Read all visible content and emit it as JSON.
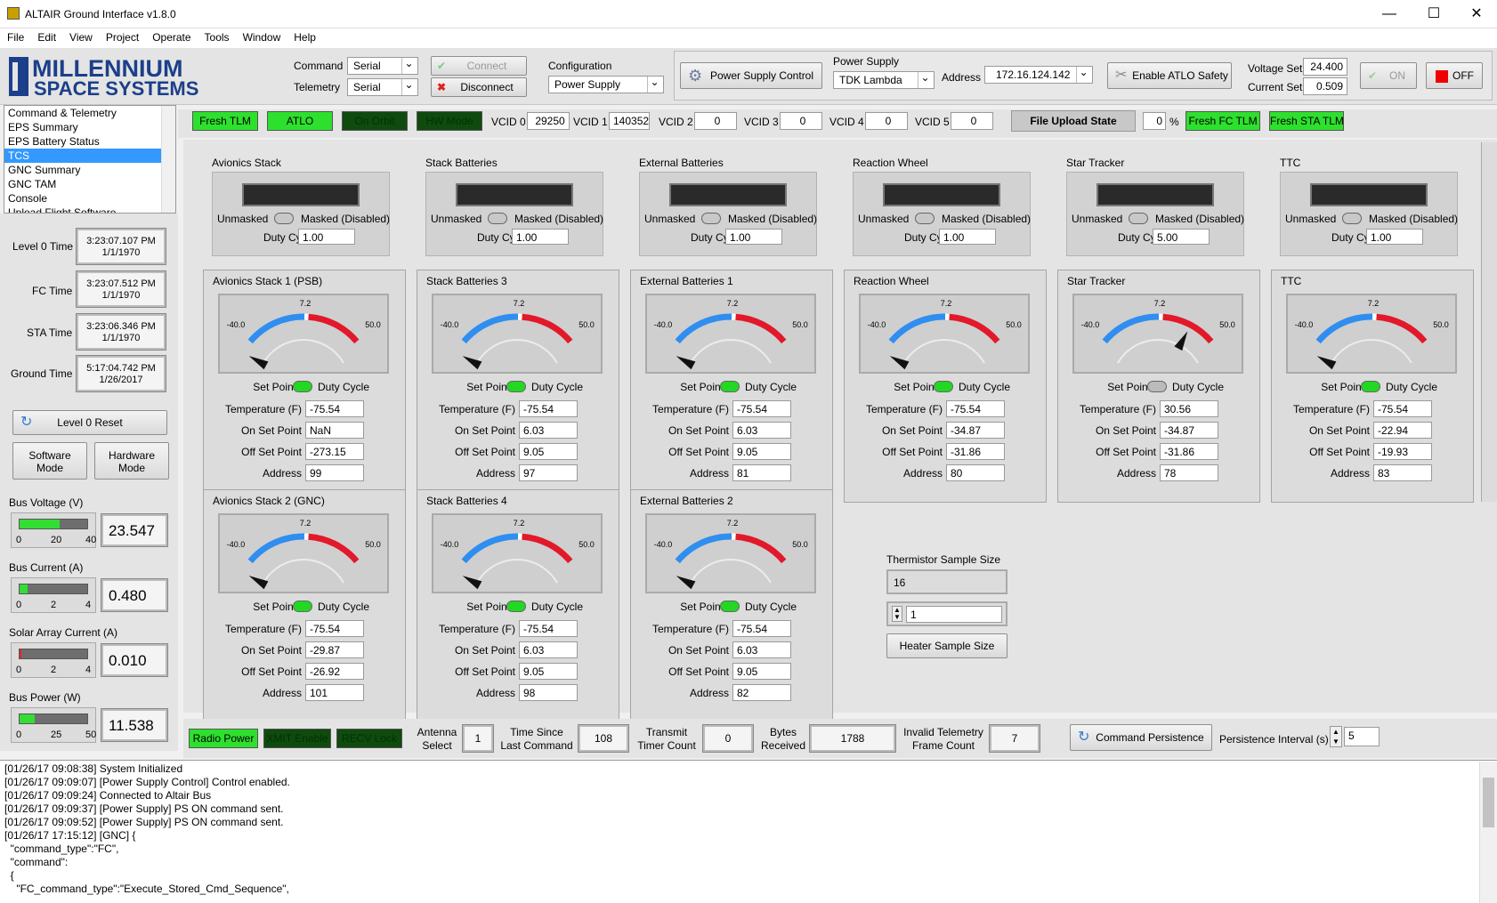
{
  "window": {
    "title": "ALTAIR Ground Interface v1.8.0",
    "minimize": "—",
    "maximize": "☐",
    "close": "✕"
  },
  "menu": [
    "File",
    "Edit",
    "View",
    "Project",
    "Operate",
    "Tools",
    "Window",
    "Help"
  ],
  "logo": {
    "line1": "MILLENNIUM",
    "line2": "SPACE SYSTEMS"
  },
  "toolbar": {
    "command_label": "Command",
    "command_value": "Serial",
    "telemetry_label": "Telemetry",
    "telemetry_value": "Serial",
    "connect": "Connect",
    "disconnect": "Disconnect",
    "configuration_label": "Configuration",
    "configuration_value": "Power Supply",
    "psc_button": "Power Supply Control",
    "power_supply_label": "Power Supply",
    "power_supply_value": "TDK Lambda",
    "address_label": "Address",
    "address_value": "172.16.124.142",
    "atlo_button": "Enable ATLO Safety",
    "voltage_label": "Voltage Set",
    "voltage_value": "24.400",
    "current_label": "Current Set",
    "current_value": "0.509",
    "on_button": "ON",
    "off_button": "OFF"
  },
  "nav": {
    "items": [
      "Command & Telemetry",
      "EPS Summary",
      "EPS Battery Status",
      "TCS",
      "GNC Summary",
      "GNC TAM",
      "Console",
      "Upload Flight Software"
    ],
    "selected": 3
  },
  "indicators": {
    "fresh_tlm": "Fresh TLM",
    "atlo": "ATLO",
    "on_orbit": "On Orbit",
    "hw_mode": "HW Mode",
    "vcids": [
      {
        "label": "VCID 0",
        "value": "29250"
      },
      {
        "label": "VCID 1",
        "value": "140352"
      },
      {
        "label": "VCID 2",
        "value": "0"
      },
      {
        "label": "VCID 3",
        "value": "0"
      },
      {
        "label": "VCID 4",
        "value": "0"
      },
      {
        "label": "VCID 5",
        "value": "0"
      }
    ],
    "file_upload_state": "File Upload State",
    "upload_pct": "0",
    "pct_sign": "%",
    "fresh_fc": "Fresh FC TLM",
    "fresh_sta": "Fresh STA TLM"
  },
  "times": [
    {
      "label": "Level 0 Time",
      "time": "3:23:07.107 PM",
      "date": "1/1/1970"
    },
    {
      "label": "FC Time",
      "time": "3:23:07.512 PM",
      "date": "1/1/1970"
    },
    {
      "label": "STA Time",
      "time": "3:23:06.346 PM",
      "date": "1/1/1970"
    },
    {
      "label": "Ground Time",
      "time": "5:17:04.742 PM",
      "date": "1/26/2017"
    }
  ],
  "left_buttons": {
    "level0_reset": "Level 0 Reset",
    "software_mode_1": "Software",
    "software_mode_2": "Mode",
    "hardware_mode_1": "Hardware",
    "hardware_mode_2": "Mode"
  },
  "meters": [
    {
      "label": "Bus Voltage (V)",
      "value": "23.547",
      "fraction": 0.59,
      "color": "#33dd33",
      "ticks": [
        "0",
        "20",
        "40"
      ]
    },
    {
      "label": "Bus Current (A)",
      "value": "0.480",
      "fraction": 0.12,
      "color": "#33dd33",
      "ticks": [
        "0",
        "2",
        "4"
      ]
    },
    {
      "label": "Solar Array Current (A)",
      "value": "0.010",
      "fraction": 0.02,
      "color": "#ee2222",
      "ticks": [
        "0",
        "2",
        "4"
      ]
    },
    {
      "label": "Bus Power (W)",
      "value": "11.538",
      "fraction": 0.23,
      "color": "#33dd33",
      "ticks": [
        "0",
        "25",
        "50"
      ]
    }
  ],
  "heaters": [
    {
      "title": "Avionics Stack",
      "unmasked": "Unmasked",
      "masked": "Masked (Disabled)",
      "duty_label": "Duty Cycle",
      "duty": "1.00"
    },
    {
      "title": "Stack Batteries",
      "unmasked": "Unmasked",
      "masked": "Masked (Disabled)",
      "duty_label": "Duty Cycle",
      "duty": "1.00"
    },
    {
      "title": "External Batteries",
      "unmasked": "Unmasked",
      "masked": "Masked (Disabled)",
      "duty_label": "Duty Cycle",
      "duty": "1.00"
    },
    {
      "title": "Reaction Wheel",
      "unmasked": "Unmasked",
      "masked": "Masked (Disabled)",
      "duty_label": "Duty Cycle",
      "duty": "1.00"
    },
    {
      "title": "Star Tracker",
      "unmasked": "Unmasked",
      "masked": "Masked (Disabled)",
      "duty_label": "Duty Cycle",
      "duty": "5.00"
    },
    {
      "title": "TTC",
      "unmasked": "Unmasked",
      "masked": "Masked (Disabled)",
      "duty_label": "Duty Cycle",
      "duty": "1.00"
    }
  ],
  "gauge_scale": {
    "min": "-40.0",
    "mid": "7.2",
    "max": "50.0"
  },
  "thermistors": [
    {
      "title": "Avionics Stack 1 (PSB)",
      "temp": "-75.54",
      "on_sp": "NaN",
      "off_sp": "-273.15",
      "addr": "99",
      "t": -75.54,
      "setpoints_on": true
    },
    {
      "title": "Stack Batteries 3",
      "temp": "-75.54",
      "on_sp": "6.03",
      "off_sp": "9.05",
      "addr": "97",
      "t": -75.54,
      "setpoints_on": true
    },
    {
      "title": "External Batteries 1",
      "temp": "-75.54",
      "on_sp": "6.03",
      "off_sp": "9.05",
      "addr": "81",
      "t": -75.54,
      "setpoints_on": true
    },
    {
      "title": "Reaction Wheel",
      "temp": "-75.54",
      "on_sp": "-34.87",
      "off_sp": "-31.86",
      "addr": "80",
      "t": -75.54,
      "setpoints_on": true
    },
    {
      "title": "Star Tracker",
      "temp": "30.56",
      "on_sp": "-34.87",
      "off_sp": "-31.86",
      "addr": "78",
      "t": 30.56,
      "setpoints_on": false
    },
    {
      "title": "TTC",
      "temp": "-75.54",
      "on_sp": "-22.94",
      "off_sp": "-19.93",
      "addr": "83",
      "t": -75.54,
      "setpoints_on": true
    },
    {
      "title": "Avionics Stack 2 (GNC)",
      "temp": "-75.54",
      "on_sp": "-29.87",
      "off_sp": "-26.92",
      "addr": "101",
      "t": -75.54,
      "setpoints_on": true
    },
    {
      "title": "Stack Batteries 4",
      "temp": "-75.54",
      "on_sp": "6.03",
      "off_sp": "9.05",
      "addr": "98",
      "t": -75.54,
      "setpoints_on": true
    },
    {
      "title": "External Batteries 2",
      "temp": "-75.54",
      "on_sp": "6.03",
      "off_sp": "9.05",
      "addr": "82",
      "t": -75.54,
      "setpoints_on": true
    }
  ],
  "row_labels": {
    "set_points": "Set Points",
    "duty_cycle": "Duty Cycle",
    "temperature": "Temperature (F)",
    "on_set_point": "On Set Point",
    "off_set_point": "Off Set Point",
    "address": "Address"
  },
  "thermistor_sample": {
    "label": "Thermistor Sample Size",
    "value": "16",
    "heater_value": "1",
    "heater_button": "Heater Sample Size"
  },
  "status": {
    "radio_power": "Radio Power",
    "xmit_enable": "XMIT Enable",
    "recv_lock": "RECV Lock",
    "antenna_1": "Antenna",
    "antenna_2": "Select",
    "antenna_value": "1",
    "tslc_1": "Time Since",
    "tslc_2": "Last Command",
    "tslc_value": "108",
    "ttc_1": "Transmit",
    "ttc_2": "Timer Count",
    "ttc_value": "0",
    "bytes_1": "Bytes",
    "bytes_2": "Received",
    "bytes_value": "1788",
    "itf_1": "Invalid Telemetry",
    "itf_2": "Frame Count",
    "itf_value": "7",
    "command_persistence": "Command Persistence",
    "persistence_label": "Persistence Interval (s)",
    "persistence_value": "5"
  },
  "log": "[01/26/17 09:08:38] System Initialized\n[01/26/17 09:09:07] [Power Supply Control] Control enabled.\n[01/26/17 09:09:24] Connected to Altair Bus\n[01/26/17 09:09:37] [Power Supply] PS ON command sent.\n[01/26/17 09:09:52] [Power Supply] PS ON command sent.\n[01/26/17 17:15:12] [GNC] {\n  \"command_type\":\"FC\",\n  \"command\":\n  {\n    \"FC_command_type\":\"Execute_Stored_Cmd_Sequence\","
}
